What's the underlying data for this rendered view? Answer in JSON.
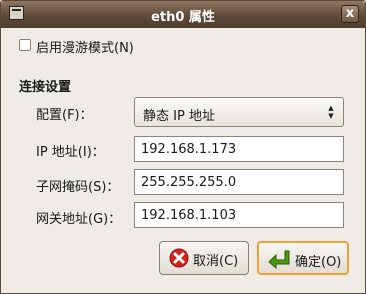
{
  "window": {
    "title": "eth0 属性",
    "close_glyph": "x"
  },
  "roaming": {
    "label": "启用漫游模式(N)",
    "checked": false
  },
  "section_title": "连接设置",
  "form": {
    "config_label": "配置(F)：",
    "config_value": "静态 IP 地址",
    "ip_label": "IP 地址(I)：",
    "ip_value": "192.168.1.173",
    "mask_label": "子网掩码(S)：",
    "mask_value": "255.255.255.0",
    "gateway_label": "网关地址(G)：",
    "gateway_value": "192.168.1.103"
  },
  "buttons": {
    "cancel_label": "取消(C)",
    "ok_label": "确定(O)"
  },
  "icons": {
    "cancel": "cancel-icon",
    "ok": "enter-arrow-icon"
  },
  "colors": {
    "titlebar": "#5f4b39",
    "ok_border": "#e8a23a",
    "cancel_red": "#d2231c",
    "ok_green": "#4e9a06"
  }
}
